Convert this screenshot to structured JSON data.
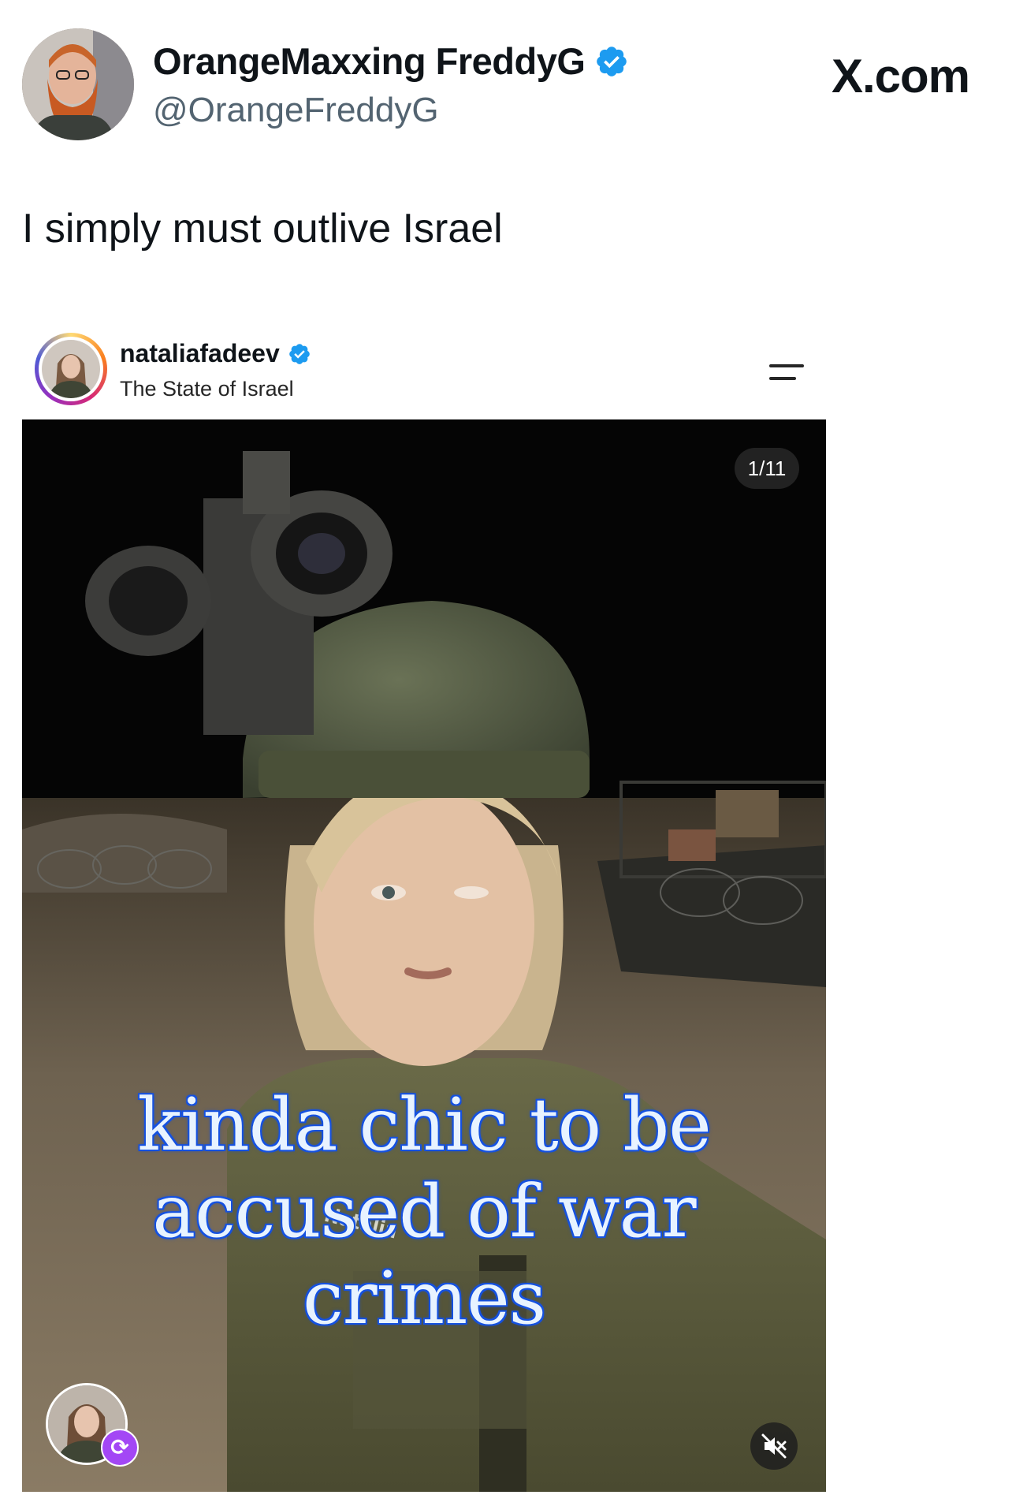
{
  "tweet": {
    "author": {
      "display_name": "OrangeMaxxing FreddyG",
      "handle": "@OrangeFreddyG",
      "verified": true
    },
    "site_label": "X.com",
    "text": "I simply must outlive Israel"
  },
  "embedded_post": {
    "username": "nataliafadeev",
    "verified": true,
    "location": "The State of Israel",
    "menu_icon": "menu-lines-icon",
    "slide_counter": "1/11",
    "caption": "kinda chic to be accused of war crimes",
    "nametag": "Natalia",
    "remix_icon": "remix-icon",
    "mute_icon": "speaker-muted-icon"
  },
  "colors": {
    "verified_blue": "#1d9bf0",
    "handle_gray": "#536471",
    "caption_outline": "#1652e0",
    "remix_purple": "#a347f5"
  }
}
